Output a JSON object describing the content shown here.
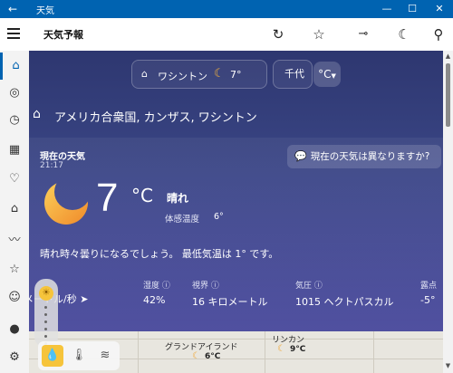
{
  "window": {
    "title": "天気",
    "back_icon": "back-arrow-icon"
  },
  "app": {
    "title": "天気予報"
  },
  "header_buttons": [
    "refresh-icon",
    "favorite-star-icon",
    "pin-icon",
    "dark-mode-moon-icon",
    "search-icon"
  ],
  "nav_items": [
    "home-icon",
    "radar-icon",
    "clock-icon",
    "calendar-icon",
    "map-pin-icon",
    "building-icon",
    "chart-icon",
    "favorites-list-icon",
    "smiley-icon",
    "account-icon",
    "settings-icon"
  ],
  "location_bar": {
    "location_name": "ワシントン",
    "temp": "7°",
    "unit_partial": "千代",
    "unit_toggle": "°C"
  },
  "breadcrumb": "アメリカ合衆国, カンザス, ワシントン",
  "current": {
    "label": "現在の天気",
    "time": "21:17",
    "feedback_button": "現在の天気は異なりますか?",
    "temp_value": "7",
    "temp_unit": "°C",
    "condition": "晴れ",
    "feels_like_label": "体感温度",
    "feels_like_value": "6°",
    "summary": "晴れ時々曇りになるでしょう。 最低気温は 1° です。"
  },
  "stats": [
    {
      "label": "",
      "value": "メートル/秒 ➤"
    },
    {
      "label": "湿度 ⓘ",
      "value": "42%"
    },
    {
      "label": "視界 ⓘ",
      "value": "16 キロメートル"
    },
    {
      "label": "気圧 ⓘ",
      "value": "1015 ヘクトパスカル"
    },
    {
      "label": "露点",
      "value": "-5°"
    }
  ],
  "map": {
    "cities": [
      {
        "name": "グランドアイランド",
        "temp": "6°C"
      },
      {
        "name": "リンカン",
        "temp": "9°C"
      }
    ],
    "layers": [
      "precipitation-icon",
      "temperature-icon",
      "wind-icon"
    ]
  }
}
